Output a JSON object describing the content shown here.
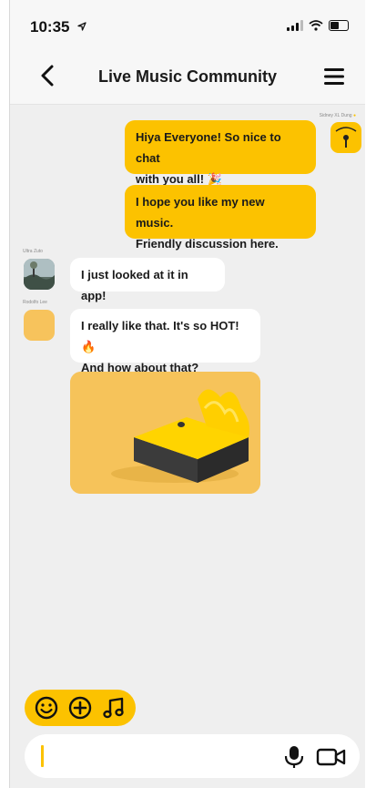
{
  "status_bar": {
    "time": "10:35",
    "location_icon": "location-arrow-icon",
    "signal_icon": "signal-icon",
    "wifi_icon": "wifi-icon",
    "battery_icon": "battery-icon"
  },
  "header": {
    "title": "Live Music Community",
    "back_icon": "chevron-left-icon",
    "menu_icon": "hamburger-menu-icon"
  },
  "messages": [
    {
      "sender": "Sidney XL Dung",
      "direction": "outgoing",
      "text_line1": "Hiya Everyone! So nice to chat",
      "text_line2": "with you all! 🎉"
    },
    {
      "sender": "",
      "direction": "outgoing",
      "text_line1": "I hope you like my new music.",
      "text_line2": "Friendly discussion here."
    },
    {
      "sender": "Ultra Zuto",
      "direction": "incoming",
      "text_line1": "I just looked at it in app!"
    },
    {
      "sender": "Rodolfo Lee",
      "direction": "incoming",
      "text_line1": "I really like that. It's so HOT! 🔥",
      "text_line2": "And how about that?"
    }
  ],
  "image_message": {
    "alt": "yellow-liquid-block-image"
  },
  "toolbar": {
    "emoji_icon": "smiley-icon",
    "add_icon": "plus-circle-icon",
    "music_icon": "music-note-icon"
  },
  "composer": {
    "value": "",
    "placeholder": "",
    "mic_icon": "microphone-icon",
    "video_icon": "video-camera-icon"
  },
  "colors": {
    "accent": "#fcc200",
    "background": "#efefef",
    "bubble_incoming": "#ffffff"
  }
}
